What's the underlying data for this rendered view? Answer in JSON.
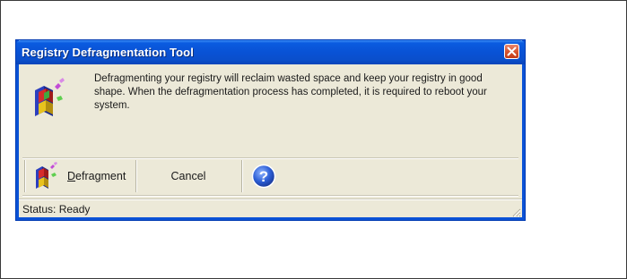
{
  "window": {
    "title": "Registry Defragmentation Tool",
    "close_icon": "close-icon",
    "app_icon": "registry-cubes-icon"
  },
  "message": "Defragmenting your registry will reclaim wasted space and keep your registry in good shape. When the defragmentation process has completed, it is required to reboot your system.",
  "toolbar": {
    "defragment_label": "Defragment",
    "defragment_accesskey": "D",
    "defragment_icon": "registry-cubes-icon",
    "cancel_label": "Cancel",
    "help_icon": "help-icon"
  },
  "status": {
    "text": "Status: Ready"
  },
  "colors": {
    "titlebar": "#0a5be0",
    "window_border": "#0b52d6",
    "background": "#ece9d8",
    "close_button": "#d9552f",
    "help_icon": "#2d5fd6"
  }
}
